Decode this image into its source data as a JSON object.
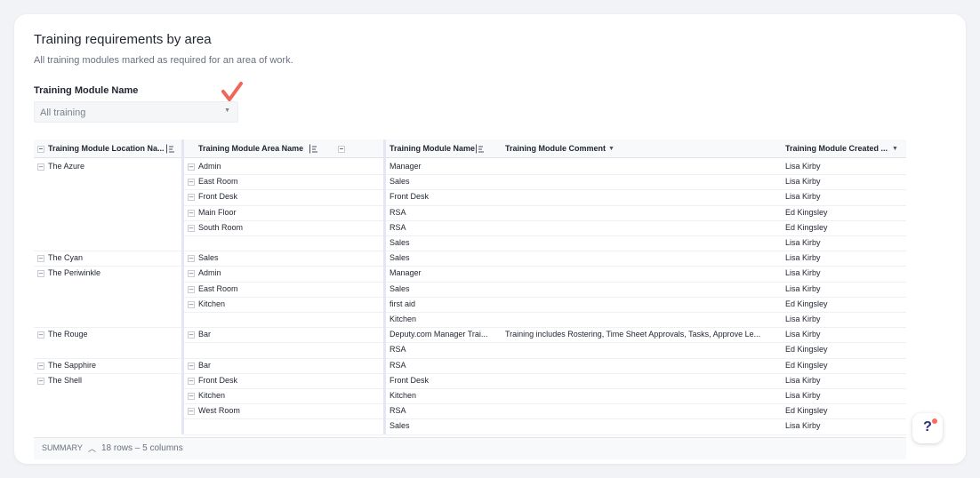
{
  "header": {
    "title": "Training requirements by area",
    "subtitle": "All training modules marked as required for an area of work."
  },
  "filter": {
    "label": "Training Module Name",
    "value": "All training",
    "annotation_color": "#f2655a"
  },
  "table": {
    "columns": [
      {
        "label": "Training Module Location Na...",
        "control": "sort-icon"
      },
      {
        "label": "Training Module Area Name",
        "control": "sort-icon"
      },
      {
        "label": "Training Module Name",
        "control": "sort-icon"
      },
      {
        "label": "Training Module Comment",
        "control": "dropdown"
      },
      {
        "label": "Training Module Created ...",
        "control": "dropdown"
      }
    ],
    "rows": [
      {
        "location": "The Azure",
        "area": "Admin",
        "name": "Manager",
        "comment": "",
        "created_by": "Lisa Kirby"
      },
      {
        "location": "",
        "area": "East Room",
        "name": "Sales",
        "comment": "",
        "created_by": "Lisa Kirby"
      },
      {
        "location": "",
        "area": "Front Desk",
        "name": "Front Desk",
        "comment": "",
        "created_by": "Lisa Kirby"
      },
      {
        "location": "",
        "area": "Main Floor",
        "name": "RSA",
        "comment": "",
        "created_by": "Ed Kingsley"
      },
      {
        "location": "",
        "area": "South Room",
        "name": "RSA",
        "comment": "",
        "created_by": "Ed Kingsley"
      },
      {
        "location": "",
        "area": "",
        "name": "Sales",
        "comment": "",
        "created_by": "Lisa Kirby"
      },
      {
        "location": "The Cyan",
        "area": "Sales",
        "name": "Sales",
        "comment": "",
        "created_by": "Lisa Kirby"
      },
      {
        "location": "The Periwinkle",
        "area": "Admin",
        "name": "Manager",
        "comment": "",
        "created_by": "Lisa Kirby"
      },
      {
        "location": "",
        "area": "East Room",
        "name": "Sales",
        "comment": "",
        "created_by": "Lisa Kirby"
      },
      {
        "location": "",
        "area": "Kitchen",
        "name": "first aid",
        "comment": "",
        "created_by": "Ed Kingsley"
      },
      {
        "location": "",
        "area": "",
        "name": "Kitchen",
        "comment": "",
        "created_by": "Lisa Kirby"
      },
      {
        "location": "The Rouge",
        "area": "Bar",
        "name": "Deputy.com Manager Trai...",
        "comment": "Training includes Rostering, Time Sheet Approvals, Tasks, Approve Le...",
        "created_by": "Lisa Kirby"
      },
      {
        "location": "",
        "area": "",
        "name": "RSA",
        "comment": "",
        "created_by": "Ed Kingsley"
      },
      {
        "location": "The Sapphire",
        "area": "Bar",
        "name": "RSA",
        "comment": "",
        "created_by": "Ed Kingsley"
      },
      {
        "location": "The Shell",
        "area": "Front Desk",
        "name": "Front Desk",
        "comment": "",
        "created_by": "Lisa Kirby"
      },
      {
        "location": "",
        "area": "Kitchen",
        "name": "Kitchen",
        "comment": "",
        "created_by": "Lisa Kirby"
      },
      {
        "location": "",
        "area": "West Room",
        "name": "RSA",
        "comment": "",
        "created_by": "Ed Kingsley"
      },
      {
        "location": "",
        "area": "",
        "name": "Sales",
        "comment": "",
        "created_by": "Lisa Kirby"
      }
    ]
  },
  "summary": {
    "label": "SUMMARY",
    "count_text": "18 rows – 5 columns"
  },
  "help": {
    "label": "?",
    "badge_color": "#ff6a5c"
  }
}
